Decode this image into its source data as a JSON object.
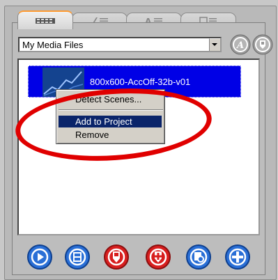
{
  "colors": {
    "selection_blue": "#0000e6",
    "menu_highlight": "#0a246a",
    "annotation_red": "#e00000",
    "active_tab_accent": "#ff9a30"
  },
  "tabs": [
    {
      "icon": "video-clips-icon",
      "active": true
    },
    {
      "icon": "transitions-icon",
      "active": false
    },
    {
      "icon": "titles-icon",
      "active": false
    },
    {
      "icon": "photos-icon",
      "active": false
    }
  ],
  "library": {
    "selected_folder": "My Media Files"
  },
  "header_buttons": [
    {
      "icon": "import-media-icon"
    },
    {
      "icon": "folder-options-icon"
    }
  ],
  "media": {
    "items": [
      {
        "name": "800x600-AccOff-32b-v01",
        "selected": true
      }
    ]
  },
  "context_menu": {
    "items": [
      {
        "label": "Detect Scenes..."
      },
      {
        "label": "Add to Project",
        "highlighted": true
      },
      {
        "label": "Remove"
      }
    ]
  },
  "toolbar": {
    "buttons": [
      {
        "icon": "play-media-icon",
        "color": "#2a6fd6"
      },
      {
        "icon": "film-clip-icon",
        "color": "#2a6fd6"
      },
      {
        "icon": "red-export-icon",
        "color": "#d81e1e"
      },
      {
        "icon": "red-add-icon",
        "color": "#d81e1e"
      },
      {
        "icon": "search-media-icon",
        "color": "#2a6fd6"
      },
      {
        "icon": "add-icon",
        "color": "#2a6fd6"
      }
    ]
  }
}
